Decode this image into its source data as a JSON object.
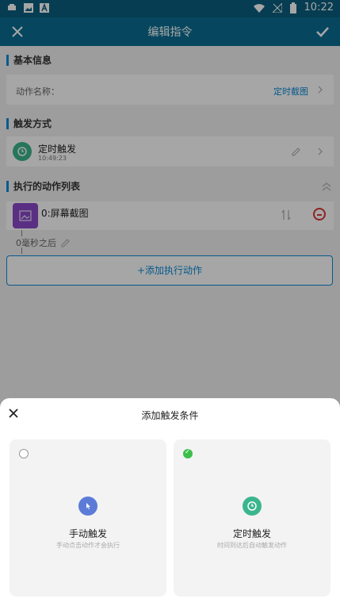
{
  "status_bar": {
    "time": "10:22"
  },
  "app_bar": {
    "title": "编辑指令"
  },
  "sections": {
    "basic_info": {
      "title": "基本信息",
      "label": "动作名称：",
      "value": "定时截图"
    },
    "trigger": {
      "title": "触发方式",
      "name": "定时触发",
      "time": "10:49:23"
    },
    "actions": {
      "title": "执行的动作列表",
      "item_title": "0:屏幕截图",
      "delay": "0毫秒之后",
      "add_label": "+添加执行动作"
    }
  },
  "sheet": {
    "title": "添加触发条件",
    "options": [
      {
        "title": "手动触发",
        "desc": "手动点击动作才会执行"
      },
      {
        "title": "定时触发",
        "desc": "时间到达后自动触发动作"
      }
    ]
  },
  "colors": {
    "accent": "#0b8bd6",
    "trigger_green": "#3bb58d",
    "action_purple": "#8b49c9",
    "manual_blue": "#5c7bd8"
  }
}
